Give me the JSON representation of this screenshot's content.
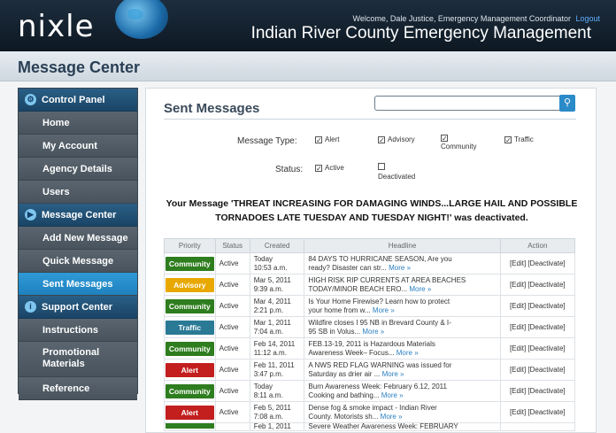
{
  "header": {
    "logo": "nixle",
    "welcome": "Welcome, Dale Justice, Emergency Management Coordinator",
    "logout": "Logout",
    "agency": "Indian River County Emergency Management"
  },
  "page_title": "Message Center",
  "sidebar": [
    {
      "type": "head",
      "label": "Control Panel",
      "icon": "gears-icon"
    },
    {
      "type": "item",
      "label": "Home"
    },
    {
      "type": "item",
      "label": "My Account"
    },
    {
      "type": "item",
      "label": "Agency Details"
    },
    {
      "type": "item",
      "label": "Users"
    },
    {
      "type": "head",
      "label": "Message Center",
      "icon": "megaphone-icon"
    },
    {
      "type": "item",
      "label": "Add New Message"
    },
    {
      "type": "item",
      "label": "Quick Message"
    },
    {
      "type": "item",
      "label": "Sent Messages",
      "active": true
    },
    {
      "type": "head",
      "label": "Support Center",
      "icon": "info-icon"
    },
    {
      "type": "item",
      "label": "Instructions"
    },
    {
      "type": "item",
      "label": "Promotional Materials",
      "tall": true
    },
    {
      "type": "item",
      "label": "Reference"
    }
  ],
  "main": {
    "title": "Sent Messages",
    "search_icon": "search-icon",
    "filters": {
      "message_type_label": "Message Type:",
      "types": [
        {
          "label": "Alert",
          "checked": true
        },
        {
          "label": "Advisory",
          "checked": true
        },
        {
          "label": "Community",
          "checked": true
        },
        {
          "label": "Traffic",
          "checked": true
        }
      ],
      "status_label": "Status:",
      "statuses": [
        {
          "label": "Active",
          "checked": true
        },
        {
          "label": "Deactivated",
          "checked": false
        }
      ]
    },
    "notice": "Your Message 'THREAT INCREASING FOR DAMAGING WINDS...LARGE HAIL AND POSSIBLE TORNADOES LATE TUESDAY AND TUESDAY NIGHT!' was deactivated.",
    "columns": [
      "Priority",
      "Status",
      "Created",
      "Headline",
      "Action"
    ],
    "more_label": "More »",
    "edit_label": "[Edit]",
    "deactivate_label": "[Deactivate]",
    "priority_colors": {
      "Community": "#2e7d1e",
      "Advisory": "#e8a800",
      "Traffic": "#2a7a96",
      "Alert": "#c31f1f"
    },
    "rows": [
      {
        "priority": "Community",
        "status": "Active",
        "created": [
          "Today",
          "10:53 a.m."
        ],
        "headline": [
          "84 DAYS TO HURRICANE SEASON, Are you",
          "ready? Disaster can str..."
        ]
      },
      {
        "priority": "Advisory",
        "status": "Active",
        "created": [
          "Mar 5, 2011",
          "9:39 a.m."
        ],
        "headline": [
          "HIGH RISK RIP CURRENTS AT AREA BEACHES",
          "TODAY/MINOR BEACH ERO..."
        ]
      },
      {
        "priority": "Community",
        "status": "Active",
        "created": [
          "Mar 4, 2011",
          "2:21 p.m."
        ],
        "headline": [
          "Is Your Home Firewise? Learn how to protect",
          "your home from w..."
        ]
      },
      {
        "priority": "Traffic",
        "status": "Active",
        "created": [
          "Mar 1, 2011",
          "7:04 a.m."
        ],
        "headline": [
          "Wildfire closes I 95 NB in Brevard County & I-",
          "95 SB in Volus..."
        ]
      },
      {
        "priority": "Community",
        "status": "Active",
        "created": [
          "Feb 14, 2011",
          "11:12 a.m."
        ],
        "headline": [
          "FEB.13-19, 2011 is Hazardous Materials",
          "Awareness Week– Focus..."
        ]
      },
      {
        "priority": "Alert",
        "status": "Active",
        "created": [
          "Feb 11, 2011",
          "3:47 p.m."
        ],
        "headline": [
          "A NWS RED FLAG WARNING was issued for",
          "Saturday as drier air ..."
        ]
      },
      {
        "priority": "Community",
        "status": "Active",
        "created": [
          "Today",
          "8:11 a.m."
        ],
        "headline": [
          "Burn Awareness Week: February 6.12, 2011",
          "Cooking and bathing..."
        ]
      },
      {
        "priority": "Alert",
        "status": "Active",
        "created": [
          "Feb 5, 2011",
          "7:08 a.m."
        ],
        "headline": [
          "Dense fog & smoke impact - Indian River",
          "County. Motorists sh..."
        ]
      },
      {
        "priority": "Community",
        "status": "",
        "created": [
          "Feb 1, 2011",
          ""
        ],
        "headline": [
          "Severe Weather Awareness Week: FEBRUARY",
          ""
        ],
        "partial": true
      }
    ]
  }
}
